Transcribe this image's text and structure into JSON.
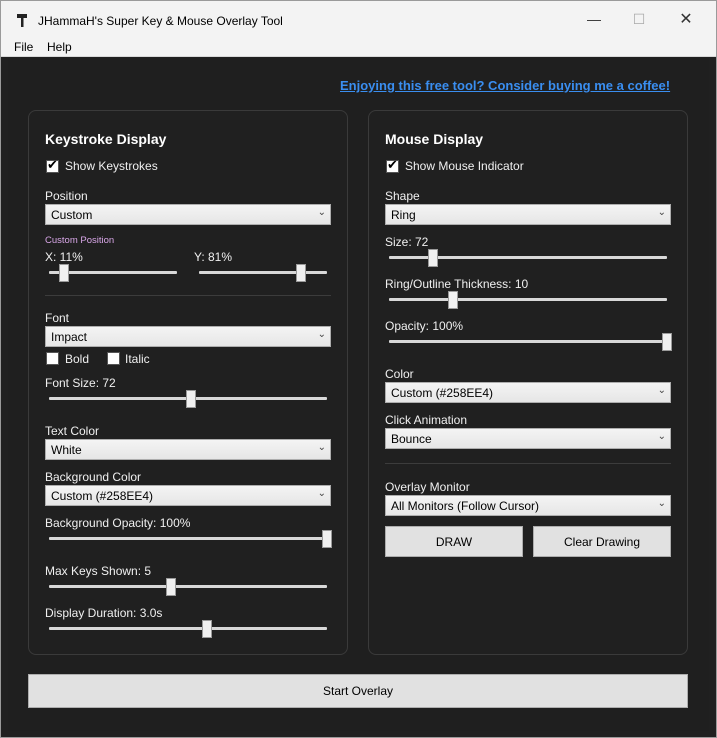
{
  "window": {
    "title": "JHammaH's Super Key & Mouse Overlay Tool",
    "min_glyph": "—",
    "max_glyph": "☐",
    "close_glyph": "✕",
    "icon": "hammer-icon"
  },
  "menu": {
    "file": "File",
    "help": "Help"
  },
  "coffee_link": "Enjoying this free tool? Consider buying me a coffee!",
  "keystroke": {
    "title": "Keystroke Display",
    "show_label": "Show Keystrokes",
    "show_checked": true,
    "position_label": "Position",
    "position_value": "Custom",
    "custom_position_label": "Custom Position",
    "x_label": "X: 11%",
    "x_value": 11,
    "y_label": "Y: 81%",
    "y_value": 81,
    "font_label": "Font",
    "font_value": "Impact",
    "bold_label": "Bold",
    "bold_checked": false,
    "italic_label": "Italic",
    "italic_checked": false,
    "font_size_label": "Font Size: 72",
    "text_color_label": "Text Color",
    "text_color_value": "White",
    "bg_color_label": "Background Color",
    "bg_color_value": "Custom (#258EE4)",
    "bg_opacity_label": "Background Opacity: 100%",
    "bg_opacity_value": 100,
    "max_keys_label": "Max Keys Shown: 5",
    "max_keys_value": 5,
    "duration_label": "Display Duration: 3.0s",
    "duration_value": 3.0
  },
  "mouse": {
    "title": "Mouse Display",
    "show_label": "Show Mouse Indicator",
    "show_checked": true,
    "shape_label": "Shape",
    "shape_value": "Ring",
    "size_label": "Size: 72",
    "size_value": 72,
    "thickness_label": "Ring/Outline Thickness: 10",
    "thickness_value": 10,
    "opacity_label": "Opacity: 100%",
    "opacity_value": 100,
    "color_label": "Color",
    "color_value": "Custom (#258EE4)",
    "click_anim_label": "Click Animation",
    "click_anim_value": "Bounce",
    "monitor_label": "Overlay Monitor",
    "monitor_value": "All Monitors (Follow Cursor)",
    "draw_label": "DRAW",
    "clear_label": "Clear Drawing"
  },
  "start_label": "Start Overlay",
  "colors": {
    "accent_link": "#3a8ef0",
    "background": "#1f1f1f",
    "custom_color": "#258EE4"
  }
}
